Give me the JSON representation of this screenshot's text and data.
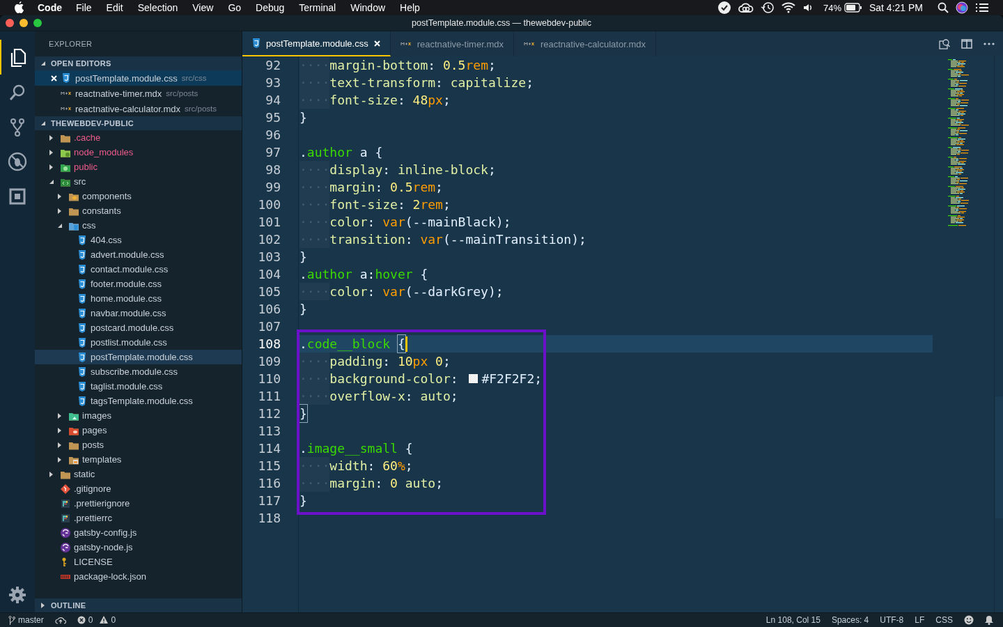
{
  "menubar": {
    "app": "Code",
    "menus": [
      "File",
      "Edit",
      "Selection",
      "View",
      "Go",
      "Debug",
      "Terminal",
      "Window",
      "Help"
    ],
    "battery": "74%",
    "clock": "Sat 4:21 PM"
  },
  "window": {
    "title": "postTemplate.module.css — thewebdev-public"
  },
  "activity_bar": [
    {
      "kind": "files",
      "selected": true
    },
    {
      "kind": "search",
      "selected": false
    },
    {
      "kind": "scm",
      "selected": false
    },
    {
      "kind": "debug",
      "selected": false
    },
    {
      "kind": "extensions",
      "selected": false
    }
  ],
  "sidebar": {
    "title": "EXPLORER",
    "open_editors": {
      "title": "OPEN EDITORS",
      "expanded": true,
      "items": [
        {
          "label": "postTemplate.module.css",
          "path": "src/css",
          "kind": "css",
          "selected": true
        },
        {
          "label": "reactnative-timer.mdx",
          "path": "src/posts",
          "kind": "mdx",
          "selected": false
        },
        {
          "label": "reactnative-calculator.mdx",
          "path": "src/posts",
          "kind": "mdx",
          "selected": false
        }
      ]
    },
    "project": {
      "title": "THEWEBDEV-PUBLIC",
      "expanded": true,
      "items": [
        {
          "label": ".cache",
          "kind": "folder",
          "ignored": true,
          "expanded": false,
          "selected": false
        },
        {
          "label": "node_modules",
          "kind": "nodefolder",
          "ignored": true,
          "expanded": false,
          "selected": false
        },
        {
          "label": "public",
          "kind": "publicfolder",
          "ignored": true,
          "expanded": false,
          "selected": false
        },
        {
          "label": "src",
          "kind": "srcfolder",
          "ignored": false,
          "expanded": true,
          "selected": false,
          "children": [
            {
              "label": "components",
              "kind": "compfolder",
              "ignored": false,
              "expanded": false,
              "selected": false
            },
            {
              "label": "constants",
              "kind": "folder",
              "ignored": false,
              "expanded": false,
              "selected": false
            },
            {
              "label": "css",
              "kind": "cssfolder",
              "ignored": false,
              "expanded": true,
              "selected": false,
              "children": [
                {
                  "label": "404.css",
                  "kind": "css",
                  "ignored": false,
                  "selected": false
                },
                {
                  "label": "advert.module.css",
                  "kind": "css",
                  "ignored": false,
                  "selected": false
                },
                {
                  "label": "contact.module.css",
                  "kind": "css",
                  "ignored": false,
                  "selected": false
                },
                {
                  "label": "footer.module.css",
                  "kind": "css",
                  "ignored": false,
                  "selected": false
                },
                {
                  "label": "home.module.css",
                  "kind": "css",
                  "ignored": false,
                  "selected": false
                },
                {
                  "label": "navbar.module.css",
                  "kind": "css",
                  "ignored": false,
                  "selected": false
                },
                {
                  "label": "postcard.module.css",
                  "kind": "css",
                  "ignored": false,
                  "selected": false
                },
                {
                  "label": "postlist.module.css",
                  "kind": "css",
                  "ignored": false,
                  "selected": false
                },
                {
                  "label": "postTemplate.module.css",
                  "kind": "css",
                  "ignored": false,
                  "selected": true
                },
                {
                  "label": "subscribe.module.css",
                  "kind": "css",
                  "ignored": false,
                  "selected": false
                },
                {
                  "label": "taglist.module.css",
                  "kind": "css",
                  "ignored": false,
                  "selected": false
                },
                {
                  "label": "tagsTemplate.module.css",
                  "kind": "css",
                  "ignored": false,
                  "selected": false
                }
              ]
            },
            {
              "label": "images",
              "kind": "imgfolder",
              "ignored": false,
              "expanded": false,
              "selected": false
            },
            {
              "label": "pages",
              "kind": "pagesfolder",
              "ignored": false,
              "expanded": false,
              "selected": false
            },
            {
              "label": "posts",
              "kind": "folder",
              "ignored": false,
              "expanded": false,
              "selected": false
            },
            {
              "label": "templates",
              "kind": "tplfolder",
              "ignored": false,
              "expanded": false,
              "selected": false
            }
          ]
        },
        {
          "label": "static",
          "kind": "folder",
          "ignored": false,
          "expanded": false,
          "selected": false
        },
        {
          "label": ".gitignore",
          "kind": "git",
          "ignored": false,
          "selected": false
        },
        {
          "label": ".prettierignore",
          "kind": "prettier",
          "ignored": false,
          "selected": false
        },
        {
          "label": ".prettierrc",
          "kind": "prettier",
          "ignored": false,
          "selected": false
        },
        {
          "label": "gatsby-config.js",
          "kind": "gatsby",
          "ignored": false,
          "selected": false
        },
        {
          "label": "gatsby-node.js",
          "kind": "gatsby",
          "ignored": false,
          "selected": false
        },
        {
          "label": "LICENSE",
          "kind": "license",
          "ignored": false,
          "selected": false
        },
        {
          "label": "package-lock.json",
          "kind": "json",
          "ignored": false,
          "selected": false
        }
      ]
    },
    "outline": {
      "title": "OUTLINE",
      "expanded": false
    }
  },
  "tabs": [
    {
      "label": "postTemplate.module.css",
      "kind": "css",
      "selected": true
    },
    {
      "label": "reactnative-timer.mdx",
      "kind": "mdx",
      "selected": false
    },
    {
      "label": "reactnative-calculator.mdx",
      "kind": "mdx",
      "selected": false
    }
  ],
  "editor": {
    "lines": [
      {
        "number": "92",
        "current": false,
        "tokens": [
          {
            "kind": "ws",
            "text": "····"
          },
          {
            "kind": "prop",
            "text": "margin-bottom"
          },
          {
            "kind": "plain",
            "text": ": "
          },
          {
            "kind": "num",
            "text": "0.5"
          },
          {
            "kind": "unit",
            "text": "rem"
          },
          {
            "kind": "plain",
            "text": ";"
          }
        ]
      },
      {
        "number": "93",
        "current": false,
        "tokens": [
          {
            "kind": "ws",
            "text": "····"
          },
          {
            "kind": "prop",
            "text": "text-transform"
          },
          {
            "kind": "plain",
            "text": ": "
          },
          {
            "kind": "prop",
            "text": "capitalize"
          },
          {
            "kind": "plain",
            "text": ";"
          }
        ]
      },
      {
        "number": "94",
        "current": false,
        "tokens": [
          {
            "kind": "ws",
            "text": "····"
          },
          {
            "kind": "prop",
            "text": "font-size"
          },
          {
            "kind": "plain",
            "text": ": "
          },
          {
            "kind": "num",
            "text": "48"
          },
          {
            "kind": "unit",
            "text": "px"
          },
          {
            "kind": "plain",
            "text": ";"
          }
        ]
      },
      {
        "number": "95",
        "current": false,
        "tokens": [
          {
            "kind": "plain",
            "text": "}"
          }
        ]
      },
      {
        "number": "96",
        "current": false
      },
      {
        "number": "97",
        "current": false,
        "tokens": [
          {
            "kind": "plain",
            "text": "."
          },
          {
            "kind": "sel",
            "text": "author"
          },
          {
            "kind": "plain",
            "text": " a {"
          }
        ]
      },
      {
        "number": "98",
        "current": false,
        "tokens": [
          {
            "kind": "ws",
            "text": "····"
          },
          {
            "kind": "prop",
            "text": "display"
          },
          {
            "kind": "plain",
            "text": ": "
          },
          {
            "kind": "prop",
            "text": "inline-block"
          },
          {
            "kind": "plain",
            "text": ";"
          }
        ]
      },
      {
        "number": "99",
        "current": false,
        "tokens": [
          {
            "kind": "ws",
            "text": "····"
          },
          {
            "kind": "prop",
            "text": "margin"
          },
          {
            "kind": "plain",
            "text": ": "
          },
          {
            "kind": "num",
            "text": "0.5"
          },
          {
            "kind": "unit",
            "text": "rem"
          },
          {
            "kind": "plain",
            "text": ";"
          }
        ]
      },
      {
        "number": "100",
        "current": false,
        "tokens": [
          {
            "kind": "ws",
            "text": "····"
          },
          {
            "kind": "prop",
            "text": "font-size"
          },
          {
            "kind": "plain",
            "text": ": "
          },
          {
            "kind": "num",
            "text": "2"
          },
          {
            "kind": "unit",
            "text": "rem"
          },
          {
            "kind": "plain",
            "text": ";"
          }
        ]
      },
      {
        "number": "101",
        "current": false,
        "tokens": [
          {
            "kind": "ws",
            "text": "····"
          },
          {
            "kind": "prop",
            "text": "color"
          },
          {
            "kind": "plain",
            "text": ": "
          },
          {
            "kind": "unit",
            "text": "var"
          },
          {
            "kind": "plain",
            "text": "(--mainBlack);"
          }
        ]
      },
      {
        "number": "102",
        "current": false,
        "tokens": [
          {
            "kind": "ws",
            "text": "····"
          },
          {
            "kind": "prop",
            "text": "transition"
          },
          {
            "kind": "plain",
            "text": ": "
          },
          {
            "kind": "unit",
            "text": "var"
          },
          {
            "kind": "plain",
            "text": "(--mainTransition);"
          }
        ]
      },
      {
        "number": "103",
        "current": false,
        "tokens": [
          {
            "kind": "plain",
            "text": "}"
          }
        ]
      },
      {
        "number": "104",
        "current": false,
        "tokens": [
          {
            "kind": "plain",
            "text": "."
          },
          {
            "kind": "sel",
            "text": "author"
          },
          {
            "kind": "plain",
            "text": " a:"
          },
          {
            "kind": "sel",
            "text": "hover"
          },
          {
            "kind": "plain",
            "text": " {"
          }
        ]
      },
      {
        "number": "105",
        "current": false,
        "tokens": [
          {
            "kind": "ws",
            "text": "····"
          },
          {
            "kind": "prop",
            "text": "color"
          },
          {
            "kind": "plain",
            "text": ": "
          },
          {
            "kind": "unit",
            "text": "var"
          },
          {
            "kind": "plain",
            "text": "(--darkGrey);"
          }
        ]
      },
      {
        "number": "106",
        "current": false,
        "tokens": [
          {
            "kind": "plain",
            "text": "}"
          }
        ]
      },
      {
        "number": "107",
        "current": false
      },
      {
        "number": "108",
        "current": true,
        "tokens": [
          {
            "kind": "plain",
            "text": "."
          },
          {
            "kind": "sel",
            "text": "code__block "
          },
          {
            "kind": "match",
            "text": "{"
          }
        ]
      },
      {
        "number": "109",
        "current": false,
        "tokens": [
          {
            "kind": "ws",
            "text": "····"
          },
          {
            "kind": "prop",
            "text": "padding"
          },
          {
            "kind": "plain",
            "text": ": "
          },
          {
            "kind": "num",
            "text": "10"
          },
          {
            "kind": "unit",
            "text": "px "
          },
          {
            "kind": "num",
            "text": "0"
          },
          {
            "kind": "plain",
            "text": ";"
          }
        ]
      },
      {
        "number": "110",
        "current": false,
        "tokens": [
          {
            "kind": "ws",
            "text": "····"
          },
          {
            "kind": "prop",
            "text": "background-color"
          },
          {
            "kind": "plain",
            "text": ": "
          },
          {
            "kind": "color",
            "text": "#F2F2F2"
          },
          {
            "kind": "plain",
            "text": ";"
          }
        ]
      },
      {
        "number": "111",
        "current": false,
        "tokens": [
          {
            "kind": "ws",
            "text": "····"
          },
          {
            "kind": "prop",
            "text": "overflow-x"
          },
          {
            "kind": "plain",
            "text": ": "
          },
          {
            "kind": "prop",
            "text": "auto"
          },
          {
            "kind": "plain",
            "text": ";"
          }
        ]
      },
      {
        "number": "112",
        "current": false,
        "tokens": [
          {
            "kind": "match",
            "text": "}"
          }
        ]
      },
      {
        "number": "113",
        "current": false
      },
      {
        "number": "114",
        "current": false,
        "tokens": [
          {
            "kind": "plain",
            "text": "."
          },
          {
            "kind": "sel",
            "text": "image__small"
          },
          {
            "kind": "plain",
            "text": " {"
          }
        ]
      },
      {
        "number": "115",
        "current": false,
        "tokens": [
          {
            "kind": "ws",
            "text": "····"
          },
          {
            "kind": "prop",
            "text": "width"
          },
          {
            "kind": "plain",
            "text": ": "
          },
          {
            "kind": "num",
            "text": "60"
          },
          {
            "kind": "unit",
            "text": "%"
          },
          {
            "kind": "plain",
            "text": ";"
          }
        ]
      },
      {
        "number": "116",
        "current": false,
        "tokens": [
          {
            "kind": "ws",
            "text": "····"
          },
          {
            "kind": "prop",
            "text": "margin"
          },
          {
            "kind": "plain",
            "text": ": "
          },
          {
            "kind": "num",
            "text": "0 "
          },
          {
            "kind": "prop",
            "text": "auto"
          },
          {
            "kind": "plain",
            "text": ";"
          }
        ]
      },
      {
        "number": "117",
        "current": false,
        "tokens": [
          {
            "kind": "plain",
            "text": "}"
          }
        ]
      },
      {
        "number": "118",
        "current": false
      }
    ]
  },
  "status_bar": {
    "branch": "master",
    "errors": "0",
    "warnings": "0",
    "position": "Ln 108, Col 15",
    "indent": "Spaces: 4",
    "encoding": "UTF-8",
    "eol": "LF",
    "language": "CSS"
  }
}
